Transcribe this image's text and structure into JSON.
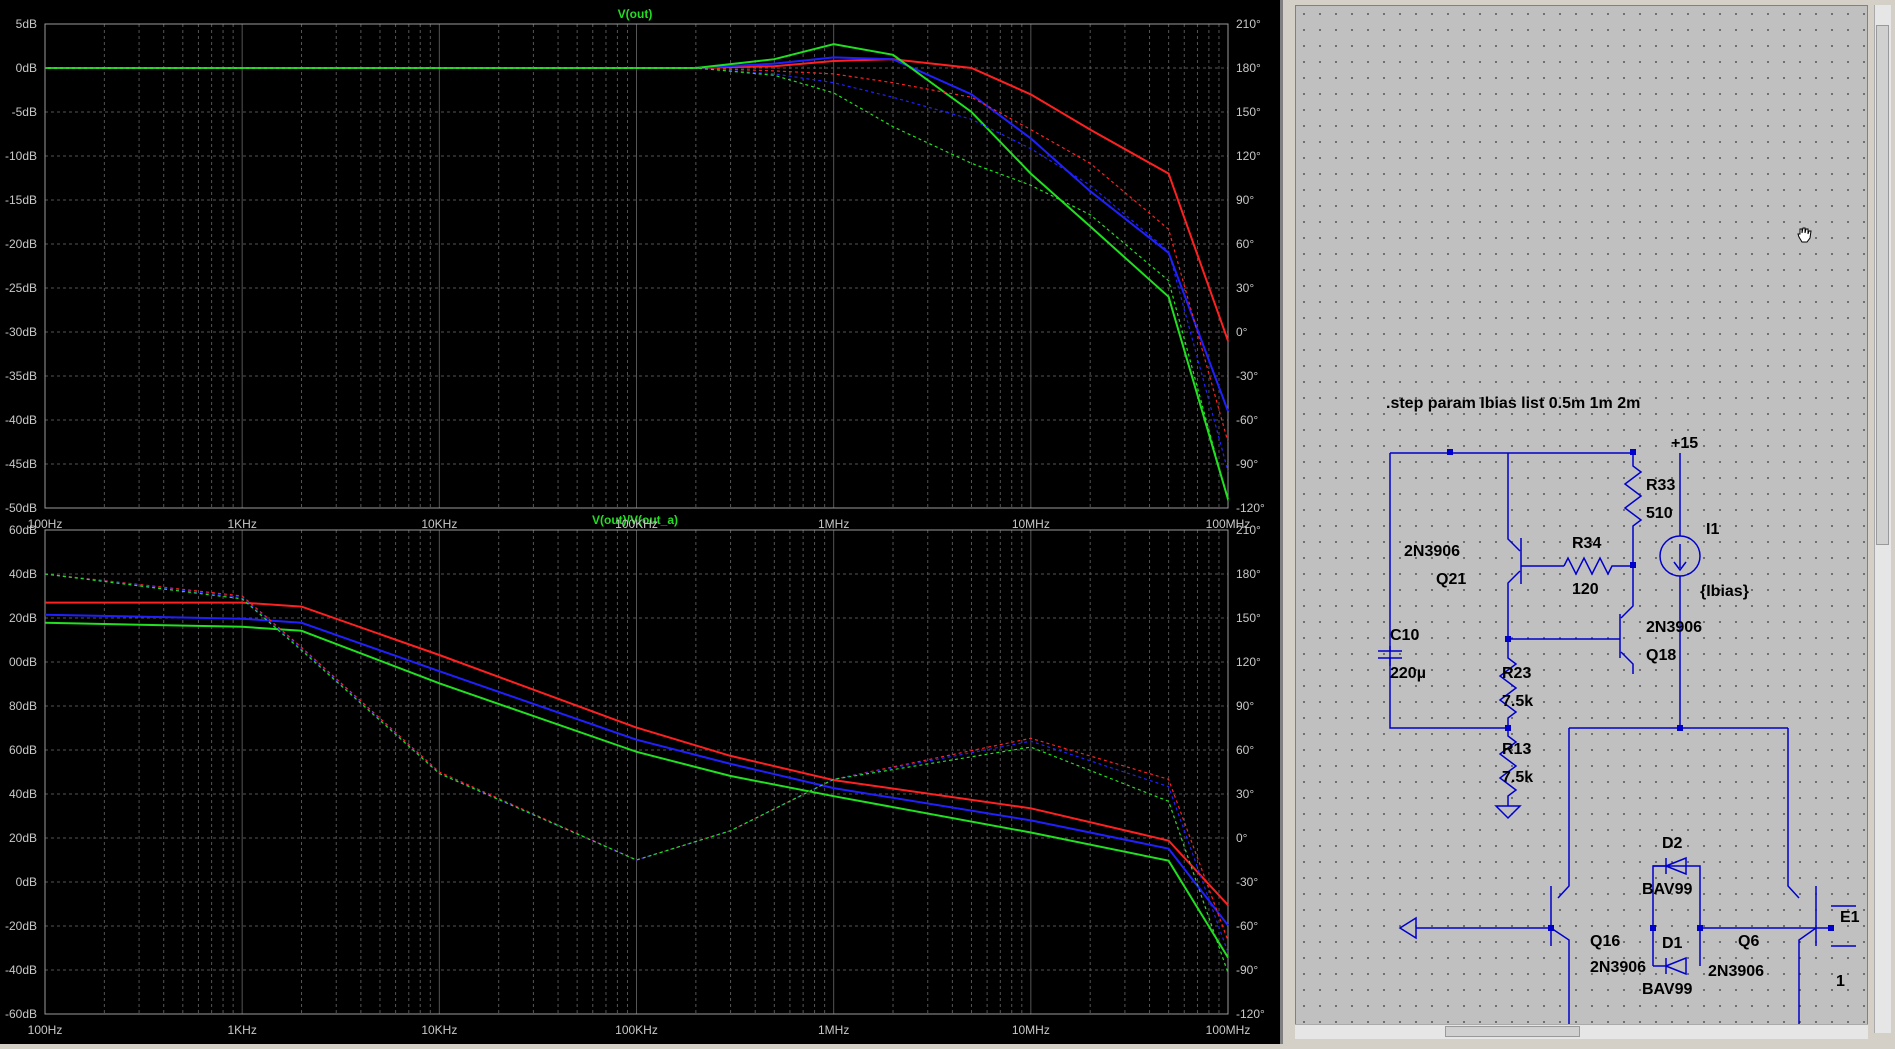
{
  "top_plot": {
    "title": "V(out)"
  },
  "bottom_plot": {
    "title": "V(out)/V(out_a)"
  },
  "colors": {
    "background": "#000000",
    "grid": "#555555",
    "axis_text": "#c8c8c8",
    "title_text": "#22dd22",
    "series": [
      "#ff2020",
      "#2020ff",
      "#20e020"
    ],
    "wire": "#0000cc"
  },
  "schematic": {
    "directive": ".step param Ibias list 0.5m 1m 2m",
    "labels": {
      "vcc": "+15",
      "r33_name": "R33",
      "r33_val": "510",
      "i1_name": "I1",
      "i1_val": "{Ibias}",
      "r34_name": "R34",
      "r34_val": "120",
      "q21_type": "2N3906",
      "q21_name": "Q21",
      "q18_type": "2N3906",
      "q18_name": "Q18",
      "c10_name": "C10",
      "c10_val": "220µ",
      "r23_name": "R23",
      "r23_val": "7.5k",
      "r13_name": "R13",
      "r13_val": "7.5k",
      "d2_name": "D2",
      "d2_val": "BAV99",
      "d1_name": "D1",
      "d1_val": "BAV99",
      "q16_name": "Q16",
      "q16_type": "2N3906",
      "q6_name": "Q6",
      "q6_type": "2N3906",
      "e1_name": "E1",
      "e1_val": "1"
    }
  },
  "chart_data": [
    {
      "type": "line",
      "title": "V(out)",
      "xscale": "log",
      "xlim": [
        100,
        100000000
      ],
      "x_ticks": [
        "100Hz",
        "1KHz",
        "10KHz",
        "100KHz",
        "1MHz",
        "10MHz",
        "100MHz"
      ],
      "ylim": [
        -50,
        5
      ],
      "y_ticks": [
        "5dB",
        "0dB",
        "-5dB",
        "-10dB",
        "-15dB",
        "-20dB",
        "-25dB",
        "-30dB",
        "-35dB",
        "-40dB",
        "-45dB",
        "-50dB"
      ],
      "y2_ticks": [
        "210°",
        "180°",
        "150°",
        "120°",
        "90°",
        "60°",
        "30°",
        "0°",
        "-30°",
        "-60°",
        "-90°",
        "-120°"
      ],
      "grid": true,
      "x": [
        100,
        200000,
        500000,
        1000000,
        2000000,
        5000000,
        10000000,
        20000000,
        50000000,
        100000000
      ],
      "series": [
        {
          "kind": "magnitude",
          "color": "#ff2020",
          "values": [
            0,
            0,
            0.2,
            0.8,
            1,
            0,
            -3,
            -7,
            -12,
            -31
          ]
        },
        {
          "kind": "magnitude",
          "color": "#2020ff",
          "values": [
            0,
            0,
            0.5,
            1.2,
            1,
            -3,
            -8,
            -14,
            -21,
            -39
          ]
        },
        {
          "kind": "magnitude",
          "color": "#20e020",
          "values": [
            0,
            0,
            1,
            2.7,
            1.5,
            -5,
            -12,
            -18,
            -26,
            -49
          ]
        },
        {
          "kind": "phase",
          "color": "#ff2020",
          "values": [
            180,
            180,
            178,
            176,
            170,
            160,
            138,
            115,
            70,
            -75
          ]
        },
        {
          "kind": "phase",
          "color": "#2020ff",
          "values": [
            180,
            180,
            176,
            170,
            160,
            145,
            125,
            100,
            55,
            -95
          ]
        },
        {
          "kind": "phase",
          "color": "#20e020",
          "values": [
            180,
            180,
            175,
            163,
            140,
            115,
            100,
            80,
            35,
            -115
          ]
        }
      ]
    },
    {
      "type": "line",
      "title": "V(out)/V(out_a)",
      "xscale": "log",
      "xlim": [
        100,
        100000000
      ],
      "x_ticks": [
        "100Hz",
        "1KHz",
        "10KHz",
        "100KHz",
        "1MHz",
        "10MHz",
        "100MHz"
      ],
      "ylim": [
        -60,
        60
      ],
      "y_ticks": [
        "60dB",
        "40dB",
        "20dB",
        "00dB",
        "80dB",
        "60dB",
        "40dB",
        "20dB",
        "0dB",
        "-20dB",
        "-40dB",
        "-60dB"
      ],
      "y2_ticks": [
        "210°",
        "180°",
        "150°",
        "120°",
        "90°",
        "60°",
        "30°",
        "0°",
        "-30°",
        "-60°",
        "-90°",
        "-120°"
      ],
      "grid": true,
      "x": [
        100,
        1000,
        2000,
        10000,
        100000,
        300000,
        1000000,
        10000000,
        50000000,
        100000000
      ],
      "series": [
        {
          "kind": "magnitude",
          "color": "#ff2020",
          "values": [
            42,
            42,
            41,
            29,
            11,
            4,
            -2,
            -9,
            -17,
            -33
          ]
        },
        {
          "kind": "magnitude",
          "color": "#2020ff",
          "values": [
            39,
            38,
            37,
            25,
            8,
            2,
            -4,
            -12,
            -19,
            -38
          ]
        },
        {
          "kind": "magnitude",
          "color": "#20e020",
          "values": [
            37,
            36,
            35,
            22,
            5,
            -1,
            -6,
            -15,
            -22,
            -46
          ]
        },
        {
          "kind": "phase",
          "color": "#ff2020",
          "values": [
            180,
            165,
            130,
            45,
            -15,
            5,
            40,
            68,
            40,
            -70
          ]
        },
        {
          "kind": "phase",
          "color": "#2020ff",
          "values": [
            180,
            164,
            129,
            44,
            -15,
            5,
            40,
            66,
            35,
            -78
          ]
        },
        {
          "kind": "phase",
          "color": "#20e020",
          "values": [
            180,
            163,
            128,
            44,
            -15,
            5,
            40,
            62,
            25,
            -92
          ]
        }
      ]
    }
  ]
}
